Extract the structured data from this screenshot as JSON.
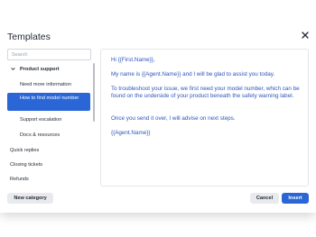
{
  "dialog": {
    "title": "Templates",
    "close_label": "×"
  },
  "sidebar": {
    "search_placeholder": "Search",
    "group": "Product support",
    "subitems": [
      "Need more information",
      "How to find model number",
      "Support escalation",
      "Docs & resources"
    ],
    "selected_index": 1,
    "categories": [
      "Quick replies",
      "Closing tickets",
      "Refunds"
    ]
  },
  "template": {
    "paragraphs": [
      "Hi {{First.Name}},",
      "My name is {{Agent.Name}} and I will be glad to assist you today.",
      "To troubleshoot your issue, we first need your model number, which can be found on the underside of your product beneath the safety warning label.",
      "Once you send it over, I will advise on next steps.",
      "{{Agent.Name}}"
    ],
    "text_color": "#2f55b8"
  },
  "footer": {
    "new_category": "New category",
    "cancel": "Cancel",
    "insert": "Insert"
  },
  "colors": {
    "accent": "#2a66d6"
  }
}
